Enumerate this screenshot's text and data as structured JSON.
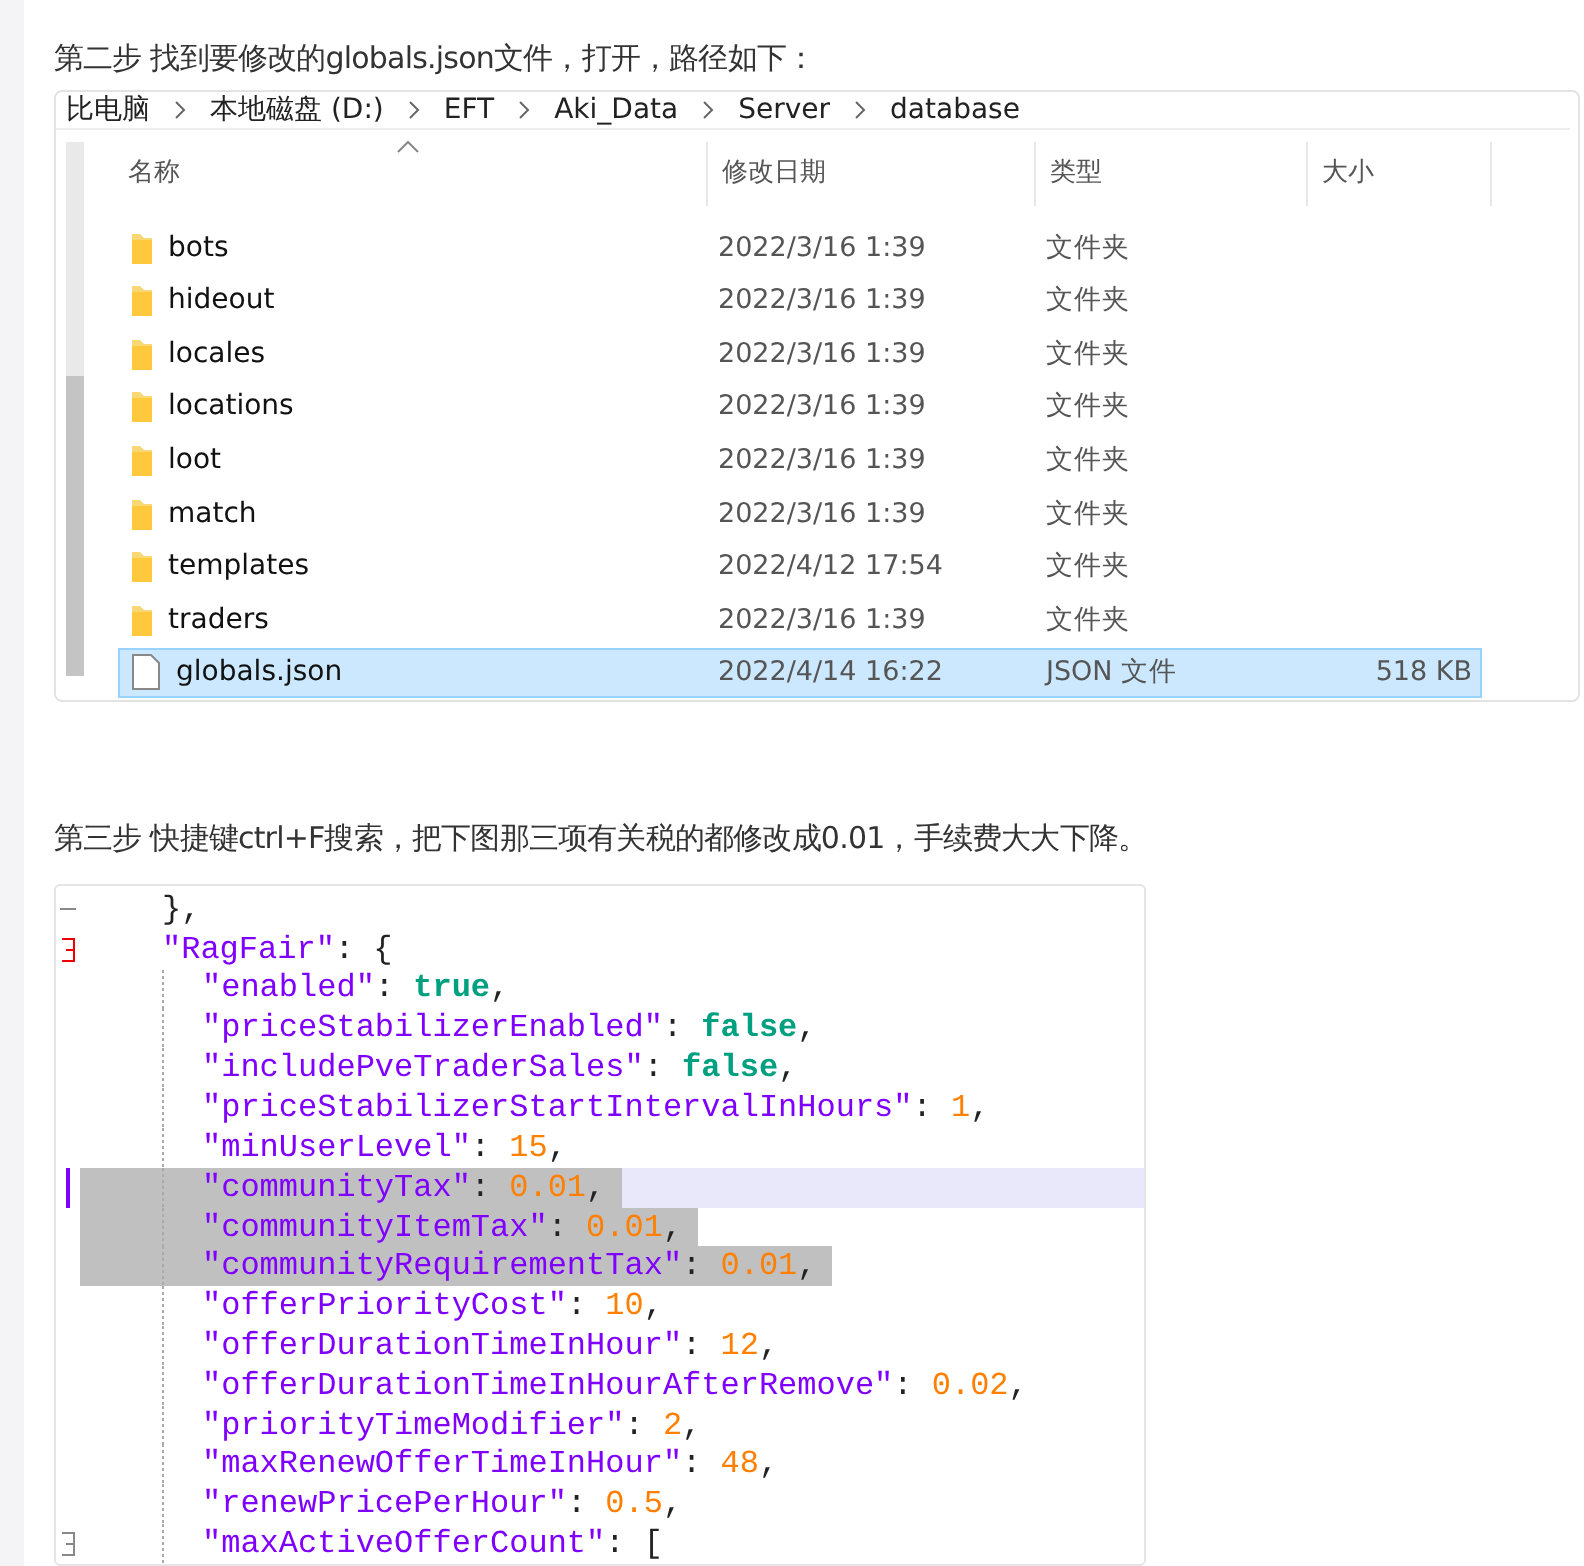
{
  "step2": "第二步 找到要修改的globals.json文件，打开，路径如下：",
  "explorer": {
    "breadcrumb": [
      "比电脑",
      "本地磁盘 (D:)",
      "EFT",
      "Aki_Data",
      "Server",
      "database"
    ],
    "columns": [
      "名称",
      "修改日期",
      "类型",
      "大小"
    ],
    "rows": [
      {
        "kind": "folder",
        "name": "bots",
        "date": "2022/3/16 1:39",
        "type": "文件夹",
        "selected": false
      },
      {
        "kind": "folder",
        "name": "hideout",
        "date": "2022/3/16 1:39",
        "type": "文件夹",
        "selected": false
      },
      {
        "kind": "folder",
        "name": "locales",
        "date": "2022/3/16 1:39",
        "type": "文件夹",
        "selected": false
      },
      {
        "kind": "folder",
        "name": "locations",
        "date": "2022/3/16 1:39",
        "type": "文件夹",
        "selected": false
      },
      {
        "kind": "folder",
        "name": "loot",
        "date": "2022/3/16 1:39",
        "type": "文件夹",
        "selected": false
      },
      {
        "kind": "folder",
        "name": "match",
        "date": "2022/3/16 1:39",
        "type": "文件夹",
        "selected": false
      },
      {
        "kind": "folder",
        "name": "templates",
        "date": "2022/4/12 17:54",
        "type": "文件夹",
        "selected": false
      },
      {
        "kind": "folder",
        "name": "traders",
        "date": "2022/3/16 1:39",
        "type": "文件夹",
        "selected": false
      },
      {
        "kind": "file",
        "name": "globals.json",
        "date": "2022/4/14 16:22",
        "type": "JSON 文件",
        "size": "518 KB",
        "selected": true
      }
    ]
  },
  "step3": "第三步 快捷键ctrl+F搜索，把下图那三项有关税的都修改成0.01，手续费大大下降。",
  "code": [
    {
      "kind": "fold-line",
      "selected": false,
      "current": false,
      "segments": [
        {
          "kind": "punct",
          "text": "},"
        }
      ]
    },
    {
      "kind": "fold-start",
      "selected": false,
      "current": false,
      "segments": [
        {
          "kind": "key",
          "text": "\"RagFair\""
        },
        {
          "kind": "punct",
          "text": ": {"
        }
      ],
      "children": [
        {
          "kind": "plain",
          "selected": false,
          "current": false,
          "segments": [
            {
              "kind": "key",
              "text": "\"enabled\""
            },
            {
              "kind": "punct",
              "text": ": "
            },
            {
              "kind": "bool",
              "text": "true"
            },
            {
              "kind": "punct",
              "text": ","
            }
          ]
        },
        {
          "kind": "plain",
          "selected": false,
          "current": false,
          "segments": [
            {
              "kind": "key",
              "text": "\"priceStabilizerEnabled\""
            },
            {
              "kind": "punct",
              "text": ": "
            },
            {
              "kind": "bool",
              "text": "false"
            },
            {
              "kind": "punct",
              "text": ","
            }
          ]
        },
        {
          "kind": "plain",
          "selected": false,
          "current": false,
          "segments": [
            {
              "kind": "key",
              "text": "\"includePveTraderSales\""
            },
            {
              "kind": "punct",
              "text": ": "
            },
            {
              "kind": "bool",
              "text": "false"
            },
            {
              "kind": "punct",
              "text": ","
            }
          ]
        },
        {
          "kind": "plain",
          "selected": false,
          "current": false,
          "segments": [
            {
              "kind": "key",
              "text": "\"priceStabilizerStartIntervalInHours\""
            },
            {
              "kind": "punct",
              "text": ": "
            },
            {
              "kind": "number",
              "text": "1"
            },
            {
              "kind": "punct",
              "text": ","
            }
          ]
        },
        {
          "kind": "plain",
          "selected": false,
          "current": false,
          "segments": [
            {
              "kind": "key",
              "text": "\"minUserLevel\""
            },
            {
              "kind": "punct",
              "text": ": "
            },
            {
              "kind": "number",
              "text": "15"
            },
            {
              "kind": "punct",
              "text": ","
            }
          ]
        },
        {
          "kind": "cursor",
          "selected": true,
          "current": true,
          "segments": [
            {
              "kind": "key",
              "text": "\"communityTax\""
            },
            {
              "kind": "punct",
              "text": ": "
            },
            {
              "kind": "number",
              "text": "0.01"
            },
            {
              "kind": "punct",
              "text": ","
            }
          ]
        },
        {
          "kind": "plain",
          "selected": true,
          "current": false,
          "segments": [
            {
              "kind": "key",
              "text": "\"communityItemTax\""
            },
            {
              "kind": "punct",
              "text": ": "
            },
            {
              "kind": "number",
              "text": "0.01"
            },
            {
              "kind": "punct",
              "text": ","
            }
          ]
        },
        {
          "kind": "plain",
          "selected": true,
          "current": false,
          "segments": [
            {
              "kind": "key",
              "text": "\"communityRequirementTax\""
            },
            {
              "kind": "punct",
              "text": ": "
            },
            {
              "kind": "number",
              "text": "0.01"
            },
            {
              "kind": "punct",
              "text": ","
            }
          ]
        },
        {
          "kind": "plain",
          "selected": false,
          "current": false,
          "segments": [
            {
              "kind": "key",
              "text": "\"offerPriorityCost\""
            },
            {
              "kind": "punct",
              "text": ": "
            },
            {
              "kind": "number",
              "text": "10"
            },
            {
              "kind": "punct",
              "text": ","
            }
          ]
        },
        {
          "kind": "plain",
          "selected": false,
          "current": false,
          "segments": [
            {
              "kind": "key",
              "text": "\"offerDurationTimeInHour\""
            },
            {
              "kind": "punct",
              "text": ": "
            },
            {
              "kind": "number",
              "text": "12"
            },
            {
              "kind": "punct",
              "text": ","
            }
          ]
        },
        {
          "kind": "plain",
          "selected": false,
          "current": false,
          "segments": [
            {
              "kind": "key",
              "text": "\"offerDurationTimeInHourAfterRemove\""
            },
            {
              "kind": "punct",
              "text": ": "
            },
            {
              "kind": "number",
              "text": "0.02"
            },
            {
              "kind": "punct",
              "text": ","
            }
          ]
        },
        {
          "kind": "plain",
          "selected": false,
          "current": false,
          "segments": [
            {
              "kind": "key",
              "text": "\"priorityTimeModifier\""
            },
            {
              "kind": "punct",
              "text": ": "
            },
            {
              "kind": "number",
              "text": "2"
            },
            {
              "kind": "punct",
              "text": ","
            }
          ]
        },
        {
          "kind": "plain",
          "selected": false,
          "current": false,
          "segments": [
            {
              "kind": "key",
              "text": "\"maxRenewOfferTimeInHour\""
            },
            {
              "kind": "punct",
              "text": ": "
            },
            {
              "kind": "number",
              "text": "48"
            },
            {
              "kind": "punct",
              "text": ","
            }
          ]
        },
        {
          "kind": "plain",
          "selected": false,
          "current": false,
          "segments": [
            {
              "kind": "key",
              "text": "\"renewPricePerHour\""
            },
            {
              "kind": "punct",
              "text": ": "
            },
            {
              "kind": "number",
              "text": "0.5"
            },
            {
              "kind": "punct",
              "text": ","
            }
          ]
        },
        {
          "kind": "fold-end",
          "selected": false,
          "current": false,
          "segments": [
            {
              "kind": "key",
              "text": "\"maxActiveOfferCount\""
            },
            {
              "kind": "punct",
              "text": ": ["
            }
          ]
        }
      ]
    }
  ]
}
